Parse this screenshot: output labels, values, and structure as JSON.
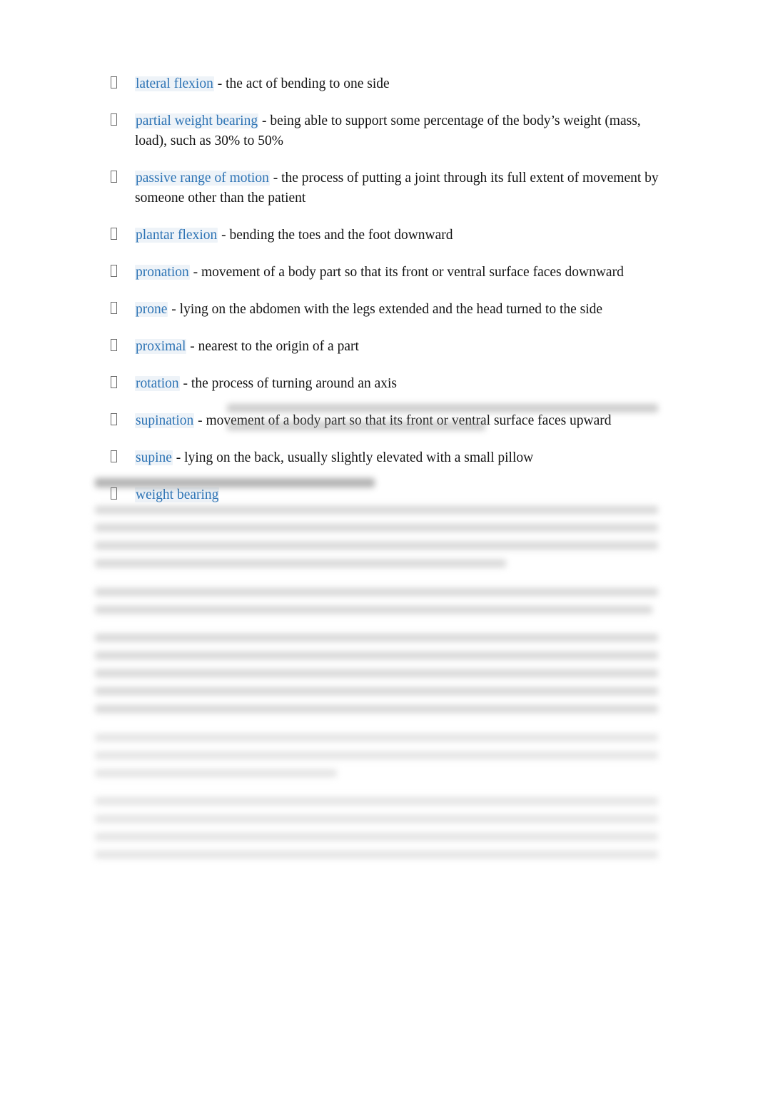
{
  "document": {
    "type": "glossary",
    "background_color": "#ffffff",
    "term_color": "#2e74b5",
    "term_highlight_color": "#eef3f8",
    "body_text_color": "#141414",
    "bullet_glyph": "missing-glyph-box"
  },
  "glossary": {
    "items": [
      {
        "term": "lateral flexion",
        "definition": " - the act of bending to one side"
      },
      {
        "term": "partial weight bearing",
        "definition": "  - being able to support some percentage of the body’s weight (mass, load), such as 30% to 50%"
      },
      {
        "term": "passive range of motion",
        "definition": "  - the process of putting a joint through its full extent of movement by someone other than the patient"
      },
      {
        "term": "plantar flexion",
        "definition": " - bending the toes and the foot downward"
      },
      {
        "term": "pronation",
        "definition": "  - movement of a body part so that its front or ventral surface faces downward"
      },
      {
        "term": "prone",
        "definition": "  - lying on the abdomen with the legs extended and the head turned to the side"
      },
      {
        "term": "proximal",
        "definition": " - nearest to the origin of a part"
      },
      {
        "term": "rotation",
        "definition": "  - the process of turning around an axis"
      },
      {
        "term": "supination",
        "definition": "  - movement of a body part so that its front or ventral surface faces upward"
      },
      {
        "term": "supine",
        "definition": "  - lying on the back, usually slightly elevated with a small pillow"
      },
      {
        "term": "weight bearing",
        "definition": ""
      }
    ]
  },
  "redacted": {
    "note": "illegible blurred content",
    "weight_bearing_definition_lines": [
      {
        "width_pct": 100
      },
      {
        "width_pct": 60
      }
    ],
    "section_heading_lines": [
      {
        "width_pct": 100
      }
    ],
    "paragraphs": [
      {
        "lines": [
          {
            "width_pct": 100
          },
          {
            "width_pct": 100
          },
          {
            "width_pct": 100
          },
          {
            "width_pct": 73
          }
        ]
      },
      {
        "lines": [
          {
            "width_pct": 100
          },
          {
            "width_pct": 99
          }
        ]
      },
      {
        "lines": [
          {
            "width_pct": 100
          },
          {
            "width_pct": 100
          },
          {
            "width_pct": 100
          },
          {
            "width_pct": 100
          },
          {
            "width_pct": 100
          }
        ]
      },
      {
        "lines": [
          {
            "width_pct": 100
          },
          {
            "width_pct": 100
          },
          {
            "width_pct": 43
          }
        ]
      },
      {
        "lines": [
          {
            "width_pct": 100
          },
          {
            "width_pct": 100
          },
          {
            "width_pct": 100
          },
          {
            "width_pct": 100
          }
        ]
      }
    ]
  }
}
